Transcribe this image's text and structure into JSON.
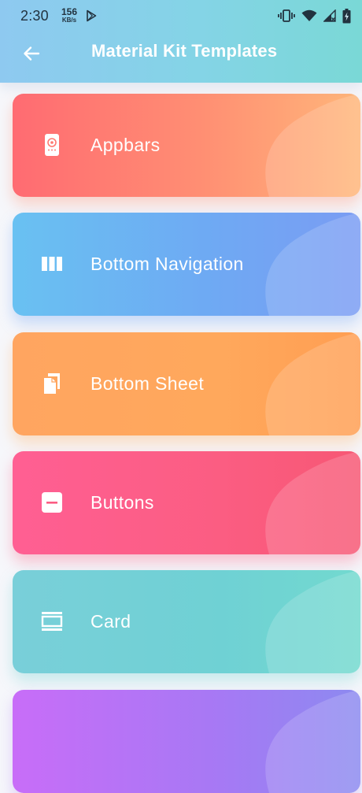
{
  "status_bar": {
    "time": "2:30",
    "net_speed_value": "156",
    "net_speed_unit": "KB/s",
    "icons": [
      "play-store-icon",
      "vibrate-icon",
      "wifi-icon",
      "cell-signal-icon",
      "battery-icon"
    ]
  },
  "app_bar": {
    "back_icon": "arrow-back-icon",
    "title": "Material Kit Templates"
  },
  "cards": [
    {
      "label": "Appbars",
      "icon": "phone-appbar-icon",
      "colors": [
        "#ff6b72",
        "#ffb67a"
      ]
    },
    {
      "label": "Bottom Navigation",
      "icon": "view-column-icon",
      "colors": [
        "#69c1f2",
        "#7a9cf3"
      ]
    },
    {
      "label": "Bottom Sheet",
      "icon": "copy-pages-icon",
      "colors": [
        "#ffa560",
        "#ff9e52"
      ]
    },
    {
      "label": "Buttons",
      "icon": "minus-box-icon",
      "colors": [
        "#ff5f93",
        "#f75774"
      ]
    },
    {
      "label": "Card",
      "icon": "card-icon",
      "colors": [
        "#79cfd9",
        "#72d9cf"
      ]
    },
    {
      "label": "",
      "icon": "",
      "colors": [
        "#c86df8",
        "#8c8af0"
      ]
    }
  ]
}
